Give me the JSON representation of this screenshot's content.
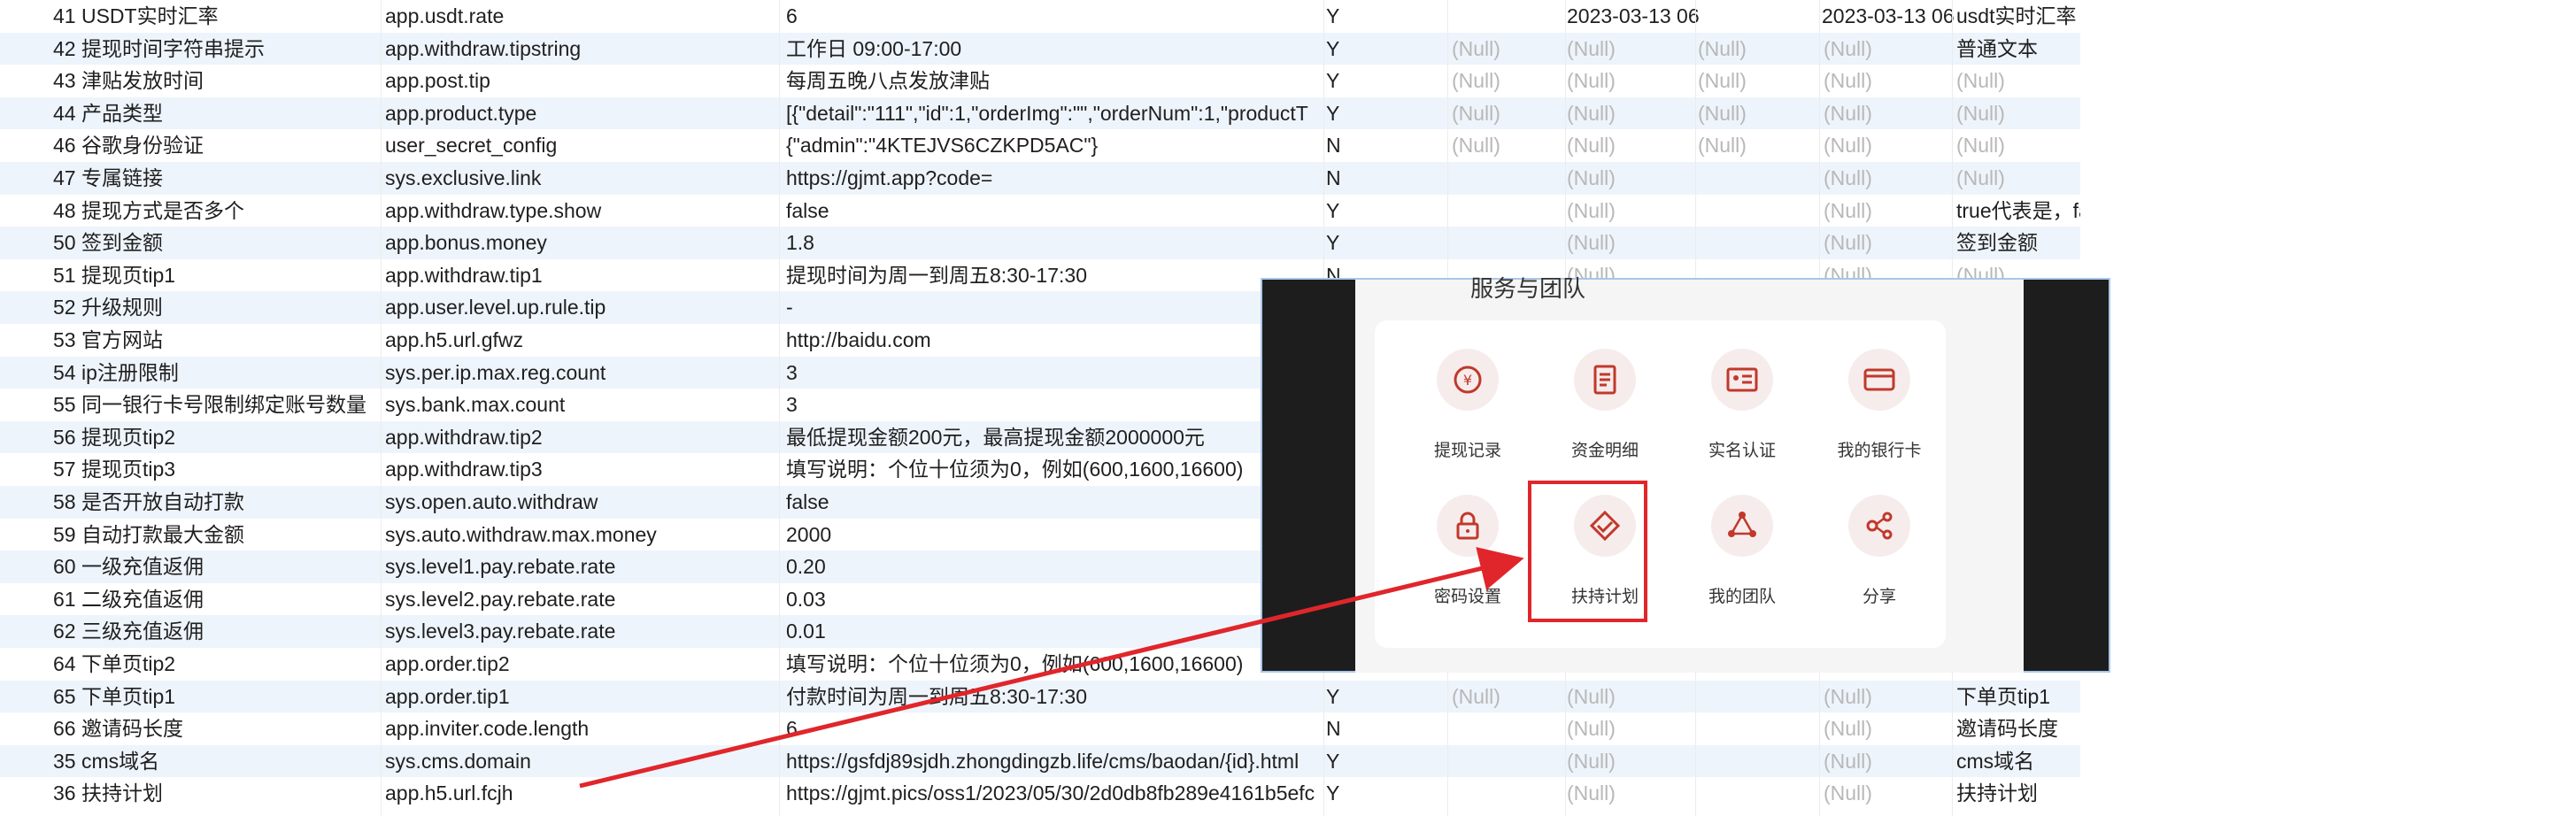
{
  "table": {
    "rows": [
      {
        "id": "41 USDT实时汇率",
        "code": "app.usdt.rate",
        "value": "6",
        "flag": "Y",
        "n1": "",
        "d1": "2023-03-13 06:",
        "n2": "",
        "n3": "",
        "d2": "2023-03-13 06:",
        "note": "usdt实时汇率"
      },
      {
        "id": "42 提现时间字符串提示",
        "code": "app.withdraw.tipstring",
        "value": "工作日 09:00-17:00",
        "flag": "Y",
        "n1": "(Null)",
        "d1": "(Null)",
        "n2": "(Null)",
        "n3": "(Null)",
        "d2": "",
        "note": "普通文本"
      },
      {
        "id": "43 津贴发放时间",
        "code": "app.post.tip",
        "value": "每周五晚八点发放津贴",
        "flag": "Y",
        "n1": "(Null)",
        "d1": "(Null)",
        "n2": "(Null)",
        "n3": "(Null)",
        "d2": "",
        "note": "(Null)"
      },
      {
        "id": "44 产品类型",
        "code": "app.product.type",
        "value": "[{\"detail\":\"111\",\"id\":1,\"orderImg\":\"\",\"orderNum\":1,\"productT",
        "flag": "Y",
        "n1": "(Null)",
        "d1": "(Null)",
        "n2": "(Null)",
        "n3": "(Null)",
        "d2": "",
        "note": "(Null)"
      },
      {
        "id": "46 谷歌身份验证",
        "code": "user_secret_config",
        "value": "{\"admin\":\"4KTEJVS6CZKPD5AC\"}",
        "flag": "N",
        "n1": "(Null)",
        "d1": "(Null)",
        "n2": "(Null)",
        "n3": "(Null)",
        "d2": "",
        "note": "(Null)"
      },
      {
        "id": "47 专属链接",
        "code": "sys.exclusive.link",
        "value": "https://gjmt.app?code=",
        "flag": "N",
        "n1": "",
        "d1": "(Null)",
        "n2": "",
        "n3": "(Null)",
        "d2": "",
        "note": "(Null)"
      },
      {
        "id": "48 提现方式是否多个",
        "code": "app.withdraw.type.show",
        "value": "false",
        "flag": "Y",
        "n1": "",
        "d1": "(Null)",
        "n2": "",
        "n3": "(Null)",
        "d2": "",
        "note": "true代表是，fal"
      },
      {
        "id": "50 签到金额",
        "code": "app.bonus.money",
        "value": "1.8",
        "flag": "Y",
        "n1": "",
        "d1": "(Null)",
        "n2": "",
        "n3": "(Null)",
        "d2": "",
        "note": "签到金额"
      },
      {
        "id": "51 提现页tip1",
        "code": "app.withdraw.tip1",
        "value": "提现时间为周一到周五8:30-17:30",
        "flag": "N",
        "n1": "",
        "d1": "(Null)",
        "n2": "",
        "n3": "(Null)",
        "d2": "",
        "note": "(Null)"
      },
      {
        "id": "52 升级规则",
        "code": "app.user.level.up.rule.tip",
        "value": "-",
        "flag": "",
        "n1": "",
        "d1": "",
        "n2": "",
        "n3": "",
        "d2": "",
        "note": ""
      },
      {
        "id": "53 官方网站",
        "code": "app.h5.url.gfwz",
        "value": "http://baidu.com",
        "flag": "",
        "n1": "",
        "d1": "",
        "n2": "",
        "n3": "",
        "d2": "",
        "note": ""
      },
      {
        "id": "54 ip注册限制",
        "code": "sys.per.ip.max.reg.count",
        "value": "3",
        "flag": "",
        "n1": "",
        "d1": "",
        "n2": "",
        "n3": "",
        "d2": "",
        "note": ""
      },
      {
        "id": "55 同一银行卡号限制绑定账号数量",
        "code": "sys.bank.max.count",
        "value": "3",
        "flag": "",
        "n1": "",
        "d1": "",
        "n2": "",
        "n3": "",
        "d2": "",
        "note": ""
      },
      {
        "id": "56 提现页tip2",
        "code": "app.withdraw.tip2",
        "value": "最低提现金额200元，最高提现金额2000000元",
        "flag": "",
        "n1": "",
        "d1": "",
        "n2": "",
        "n3": "",
        "d2": "",
        "note": ""
      },
      {
        "id": "57 提现页tip3",
        "code": "app.withdraw.tip3",
        "value": "填写说明：个位十位须为0，例如(600,1600,16600)",
        "flag": "",
        "n1": "",
        "d1": "",
        "n2": "",
        "n3": "",
        "d2": "",
        "note": ""
      },
      {
        "id": "58 是否开放自动打款",
        "code": "sys.open.auto.withdraw",
        "value": "false",
        "flag": "",
        "n1": "",
        "d1": "",
        "n2": "",
        "n3": "",
        "d2": "",
        "note": ""
      },
      {
        "id": "59 自动打款最大金额",
        "code": "sys.auto.withdraw.max.money",
        "value": "2000",
        "flag": "",
        "n1": "",
        "d1": "",
        "n2": "",
        "n3": "",
        "d2": "",
        "note": ""
      },
      {
        "id": "60 一级充值返佣",
        "code": "sys.level1.pay.rebate.rate",
        "value": "0.20",
        "flag": "",
        "n1": "",
        "d1": "",
        "n2": "",
        "n3": "",
        "d2": "",
        "note": ""
      },
      {
        "id": "61 二级充值返佣",
        "code": "sys.level2.pay.rebate.rate",
        "value": "0.03",
        "flag": "",
        "n1": "",
        "d1": "",
        "n2": "",
        "n3": "",
        "d2": "",
        "note": ""
      },
      {
        "id": "62 三级充值返佣",
        "code": "sys.level3.pay.rebate.rate",
        "value": "0.01",
        "flag": "",
        "n1": "",
        "d1": "",
        "n2": "",
        "n3": "",
        "d2": "",
        "note": ""
      },
      {
        "id": "64 下单页tip2",
        "code": "app.order.tip2",
        "value": "填写说明：个位十位须为0，例如(600,1600,16600)",
        "flag": "",
        "n1": "",
        "d1": "",
        "n2": "",
        "n3": "",
        "d2": "",
        "note": ""
      },
      {
        "id": "65 下单页tip1",
        "code": "app.order.tip1",
        "value": "付款时间为周一到周五8:30-17:30",
        "flag": "Y",
        "n1": "(Null)",
        "d1": "(Null)",
        "n2": "",
        "n3": "(Null)",
        "d2": "",
        "note": "下单页tip1"
      },
      {
        "id": "66 邀请码长度",
        "code": "app.inviter.code.length",
        "value": "6",
        "flag": "N",
        "n1": "",
        "d1": "(Null)",
        "n2": "",
        "n3": "(Null)",
        "d2": "",
        "note": "邀请码长度"
      },
      {
        "id": "35 cms域名",
        "code": "sys.cms.domain",
        "value": "https://gsfdj89sjdh.zhongdingzb.life/cms/baodan/{id}.html",
        "flag": "Y",
        "n1": "",
        "d1": "(Null)",
        "n2": "",
        "n3": "(Null)",
        "d2": "",
        "note": "cms域名"
      },
      {
        "id": "36 扶持计划",
        "code": "app.h5.url.fcjh",
        "value": "https://gjmt.pics/oss1/2023/05/30/2d0db8fb289e4161b5efc",
        "flag": "Y",
        "n1": "",
        "d1": "(Null)",
        "n2": "",
        "n3": "(Null)",
        "d2": "",
        "note": "扶持计划"
      }
    ]
  },
  "overlay": {
    "section_title": "服务与团队",
    "items": [
      {
        "label": "提现记录",
        "icon": "coin-refresh-icon"
      },
      {
        "label": "资金明细",
        "icon": "document-list-icon"
      },
      {
        "label": "实名认证",
        "icon": "id-card-icon"
      },
      {
        "label": "我的银行卡",
        "icon": "bank-card-icon"
      },
      {
        "label": "密码设置",
        "icon": "lock-icon"
      },
      {
        "label": "扶持计划",
        "icon": "handshake-diamond-icon"
      },
      {
        "label": "我的团队",
        "icon": "team-triangle-icon"
      },
      {
        "label": "分享",
        "icon": "share-icon"
      }
    ],
    "accent_color": "#c0392b",
    "highlight_color": "#e0262b"
  }
}
